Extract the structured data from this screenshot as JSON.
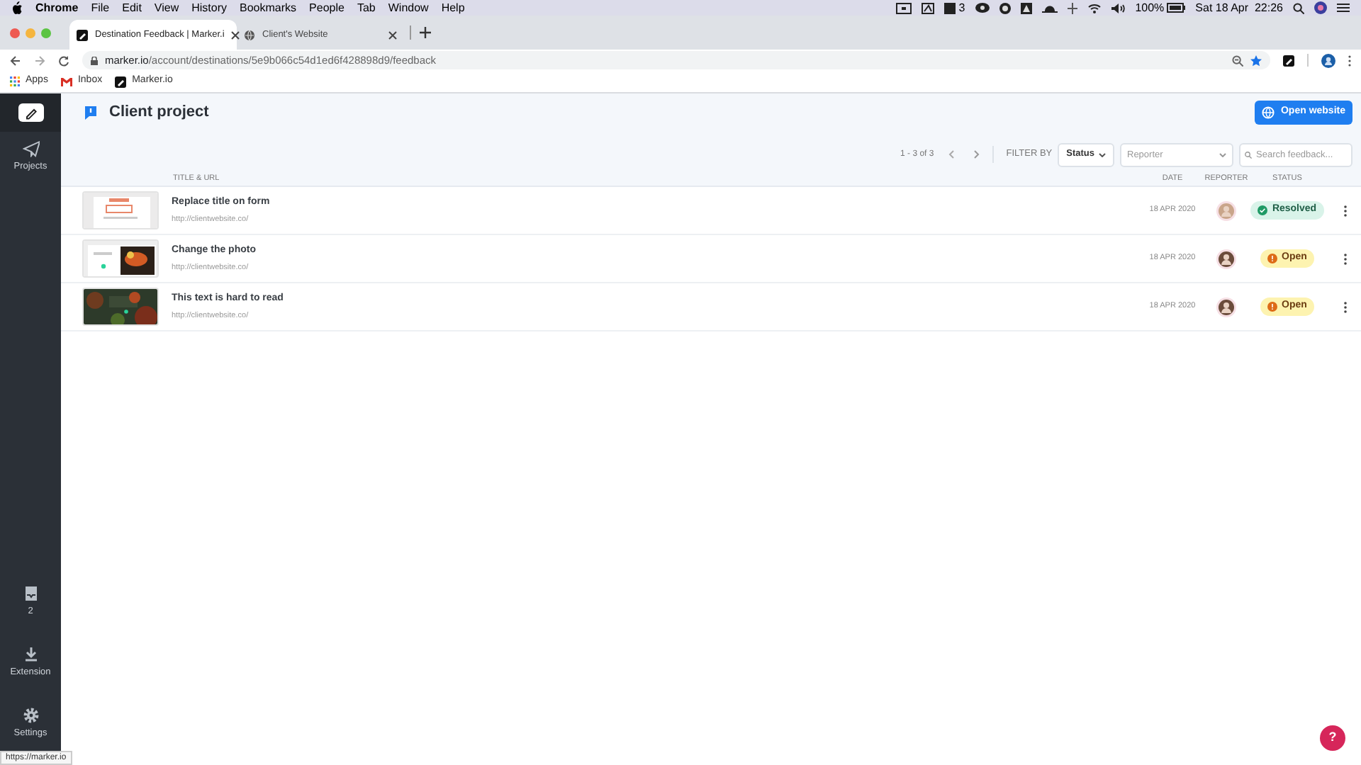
{
  "menu_bar": {
    "app": "Chrome",
    "items": [
      "File",
      "Edit",
      "View",
      "History",
      "Bookmarks",
      "People",
      "Tab",
      "Window",
      "Help"
    ],
    "badge_count": "3",
    "battery": "100%",
    "clock": "Sat 18 Apr  22:26"
  },
  "tabs": [
    {
      "title": "Destination Feedback | Marker.i",
      "selected": true
    },
    {
      "title": "Client's Website",
      "selected": false
    }
  ],
  "address_bar": {
    "host": "marker.io",
    "path": "/account/destinations/5e9b066c54d1ed6f428898d9/feedback"
  },
  "bookmarks": [
    "Apps",
    "Inbox",
    "Marker.io"
  ],
  "sidebar": {
    "items": [
      {
        "label": "Projects",
        "kind": "projects"
      }
    ],
    "bottom_items": [
      {
        "label": "2",
        "kind": "inbox"
      },
      {
        "label": "Extension",
        "kind": "download"
      },
      {
        "label": "Settings",
        "kind": "gear"
      }
    ]
  },
  "header": {
    "title": "Client project",
    "button": "Open website"
  },
  "toolbar": {
    "pagination": "1 - 3 of 3",
    "filter_label": "FILTER BY",
    "status_filter": "Status",
    "reporter_placeholder": "Reporter",
    "search_placeholder": "Search feedback..."
  },
  "table": {
    "columns": [
      "TITLE & URL",
      "DATE",
      "REPORTER",
      "STATUS"
    ],
    "rows": [
      {
        "title": "Replace title on form",
        "url": "http://clientwebsite.co/",
        "date": "18 APR 2020",
        "status": "Resolved",
        "kind": "resolved"
      },
      {
        "title": "Change the photo",
        "url": "http://clientwebsite.co/",
        "date": "18 APR 2020",
        "status": "Open",
        "kind": "open"
      },
      {
        "title": "This text is hard to read",
        "url": "http://clientwebsite.co/",
        "date": "18 APR 2020",
        "status": "Open",
        "kind": "open"
      }
    ]
  },
  "status_tooltip": "https://marker.io",
  "help_button": "?"
}
